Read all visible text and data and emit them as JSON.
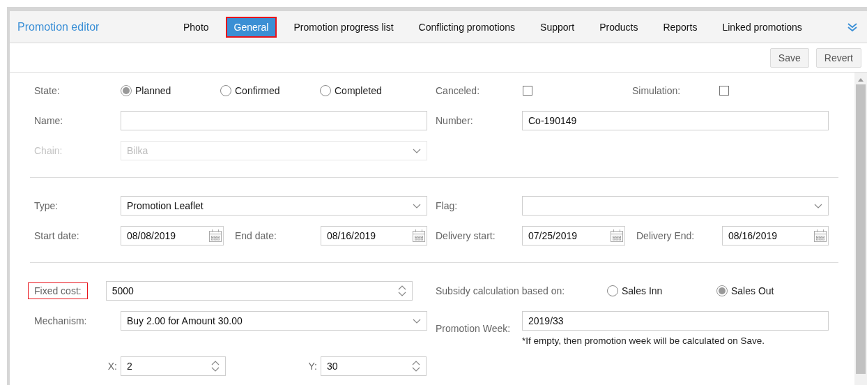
{
  "window": {
    "title": "Promotion editor"
  },
  "tabs": [
    {
      "label": "Photo",
      "selected": false,
      "highlighted": false
    },
    {
      "label": "General",
      "selected": true,
      "highlighted": true
    },
    {
      "label": "Promotion progress list",
      "selected": false,
      "highlighted": false
    },
    {
      "label": "Conflicting promotions",
      "selected": false,
      "highlighted": false
    },
    {
      "label": "Support",
      "selected": false,
      "highlighted": false
    },
    {
      "label": "Products",
      "selected": false,
      "highlighted": false
    },
    {
      "label": "Reports",
      "selected": false,
      "highlighted": false
    },
    {
      "label": "Linked promotions",
      "selected": false,
      "highlighted": false
    }
  ],
  "toolbar": {
    "buttons": [
      "Save",
      "Revert"
    ]
  },
  "form": {
    "sections": [
      {
        "rows": [
          {
            "left": {
              "kind": "radio_group",
              "label": "State:",
              "options": [
                {
                  "label": "Planned",
                  "selected": true
                },
                {
                  "label": "Confirmed",
                  "selected": false
                },
                {
                  "label": "Completed",
                  "selected": false
                }
              ]
            },
            "right": {
              "kind": "checkboxes",
              "items": [
                {
                  "label": "Canceled:",
                  "checked": false
                },
                {
                  "label": "Simulation:",
                  "checked": false
                }
              ]
            }
          },
          {
            "left": {
              "kind": "text",
              "label": "Name:"
            },
            "right": {
              "kind": "text",
              "label": "Number:",
              "value": "Co-190149"
            }
          },
          {
            "left": {
              "kind": "select",
              "label": "Chain:",
              "value": "Bilka",
              "disabled": true
            }
          }
        ]
      },
      {
        "rows": [
          {
            "left": {
              "kind": "select",
              "label": "Type:",
              "value": "Promotion Leaflet",
              "disabled": false
            },
            "right": {
              "kind": "select",
              "label": "Flag:",
              "disabled": false
            }
          },
          {
            "left": {
              "kind": "dates",
              "fields": [
                {
                  "label": "Start date:",
                  "value": "08/08/2019"
                },
                {
                  "label": "End date:",
                  "value": "08/16/2019"
                }
              ]
            },
            "right": {
              "kind": "dates",
              "fields": [
                {
                  "label": "Delivery start:",
                  "value": "07/25/2019"
                },
                {
                  "label": "Delivery End:",
                  "value": "08/16/2019"
                }
              ]
            }
          }
        ]
      },
      {
        "rows": [
          {
            "left": {
              "kind": "number",
              "label": "Fixed cost:",
              "value": "5000",
              "highlighted": true
            },
            "right": {
              "kind": "radio_group",
              "label": "Subsidy calculation based on:",
              "options": [
                {
                  "label": "Sales Inn",
                  "selected": false
                },
                {
                  "label": "Sales Out",
                  "selected": true
                }
              ]
            }
          },
          {
            "left": {
              "kind": "select",
              "label": "Mechanism:",
              "value": "Buy 2.00 for Amount 30.00",
              "disabled": false
            },
            "right": {
              "kind": "text",
              "label": "Promotion Week:",
              "value": "2019/33",
              "note": "*If empty, then promotion week will be calculated on Save."
            }
          },
          {
            "left": {
              "kind": "number_pair",
              "fields": [
                {
                  "label": "X:",
                  "value": "2"
                },
                {
                  "label": "Y:",
                  "value": "30"
                }
              ]
            }
          }
        ]
      }
    ]
  }
}
